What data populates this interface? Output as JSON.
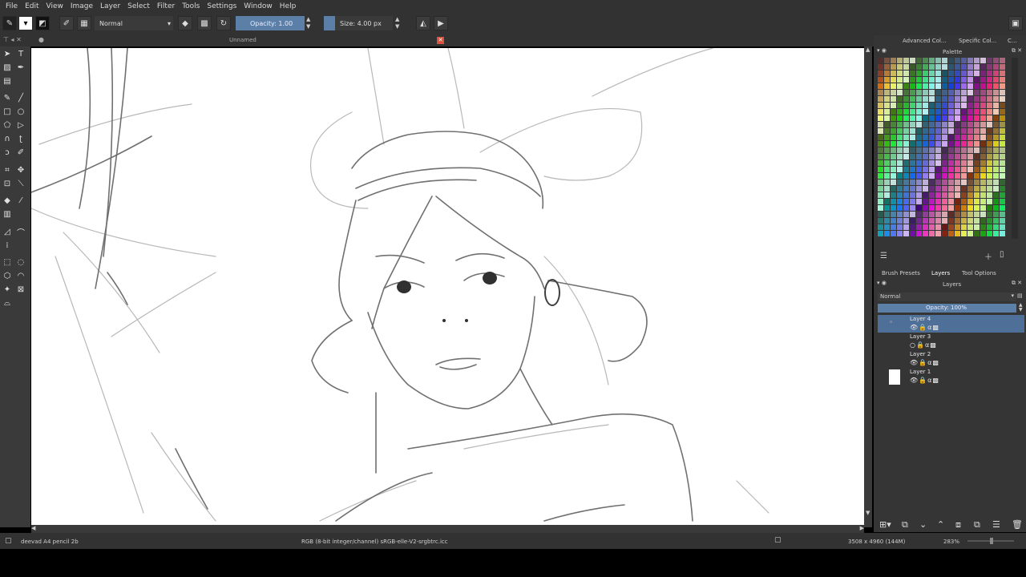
{
  "menu": [
    "File",
    "Edit",
    "View",
    "Image",
    "Layer",
    "Select",
    "Filter",
    "Tools",
    "Settings",
    "Window",
    "Help"
  ],
  "toolbar": {
    "blend_mode": "Normal",
    "opacity_label": "Opacity:  1.00",
    "size_label": "Size:  4.00 px"
  },
  "document": {
    "title": "Unnamed"
  },
  "docker": {
    "top_tabs": [
      "Advanced Col...",
      "Specific Col...",
      "C..."
    ],
    "palette_title": "Palette",
    "mid_tabs": [
      "Brush Presets",
      "Layers",
      "Tool Options"
    ],
    "layers_title": "Layers",
    "blend_mode": "Normal",
    "opacity_label": "Opacity:  100%",
    "layers": [
      {
        "name": "Layer 4",
        "selected": true
      },
      {
        "name": "Layer 3",
        "selected": false
      },
      {
        "name": "Layer 2",
        "selected": false
      },
      {
        "name": "Layer 1",
        "selected": false
      }
    ]
  },
  "status": {
    "brush": "deevad A4 pencil 2b",
    "color_profile": "RGB (8-bit integer/channel)  sRGB-elle-V2-srgbtrc.icc",
    "image_size": "3508 x 4960 (144M)",
    "zoom": "283%"
  },
  "colors": {
    "accent": "#5b7fa6",
    "selected_layer": "#4e6f98",
    "chrome": "#323232"
  }
}
